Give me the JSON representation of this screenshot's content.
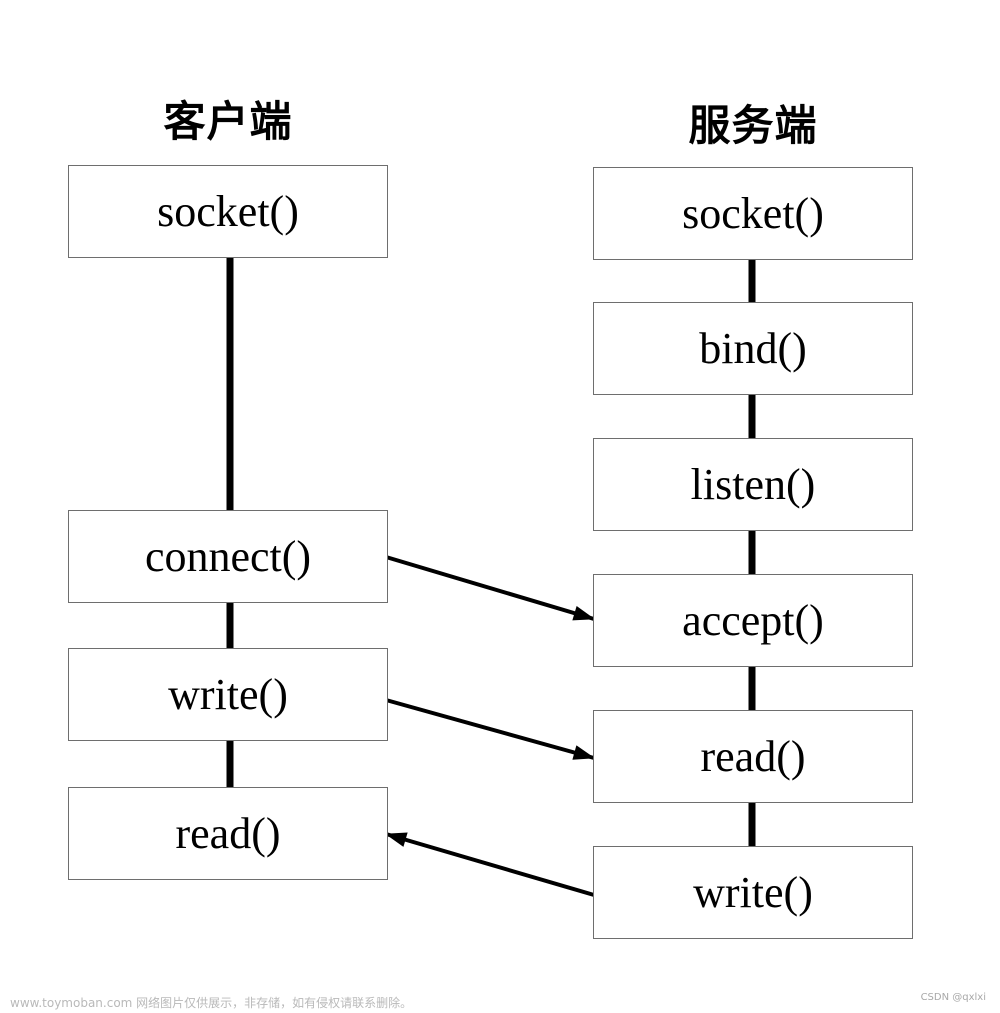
{
  "client": {
    "title": "客户端",
    "steps": [
      "socket()",
      "connect()",
      "write()",
      "read()"
    ]
  },
  "server": {
    "title": "服务端",
    "steps": [
      "socket()",
      "bind()",
      "listen()",
      "accept()",
      "read()",
      "write()"
    ]
  },
  "arrows": [
    {
      "from": "client.connect()",
      "to": "server.accept()"
    },
    {
      "from": "client.write()",
      "to": "server.read()"
    },
    {
      "from": "server.write()",
      "to": "client.read()"
    }
  ],
  "footer": {
    "watermark": "www.toymoban.com 网络图片仅供展示，非存储，如有侵权请联系删除。",
    "credit": "CSDN @qxlxi"
  }
}
